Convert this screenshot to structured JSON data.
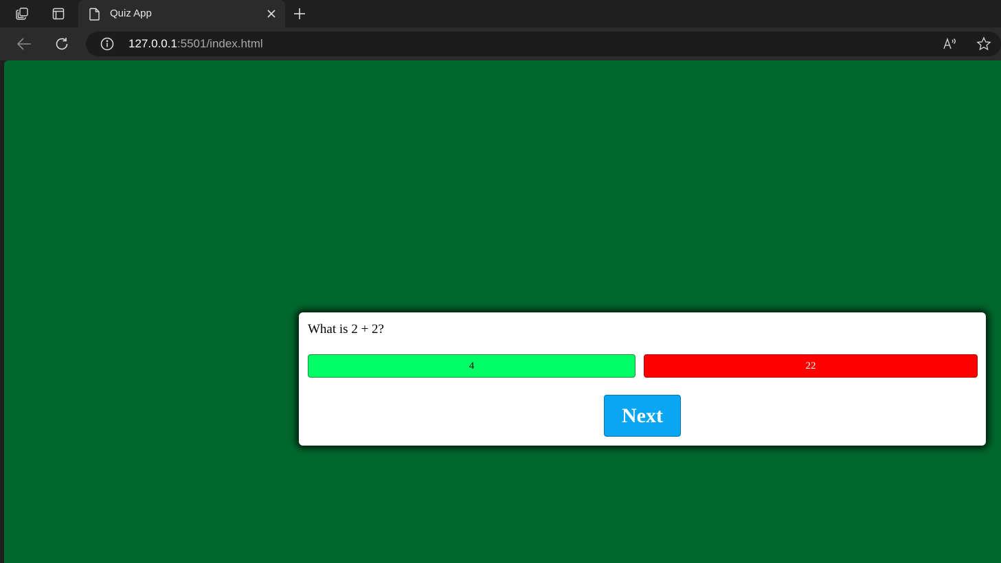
{
  "browser": {
    "tab": {
      "title": "Quiz App"
    },
    "address_bar": {
      "url_host": "127.0.0.1",
      "url_rest": ":5501/index.html"
    }
  },
  "quiz": {
    "question": "What is 2 + 2?",
    "answers": [
      {
        "label": "4",
        "state": "correct",
        "color": "#00ff66"
      },
      {
        "label": "22",
        "state": "wrong",
        "color": "#ff0000"
      }
    ],
    "next_label": "Next"
  },
  "colors": {
    "page_background": "#00682d",
    "next_button": "#0aa6f2"
  }
}
